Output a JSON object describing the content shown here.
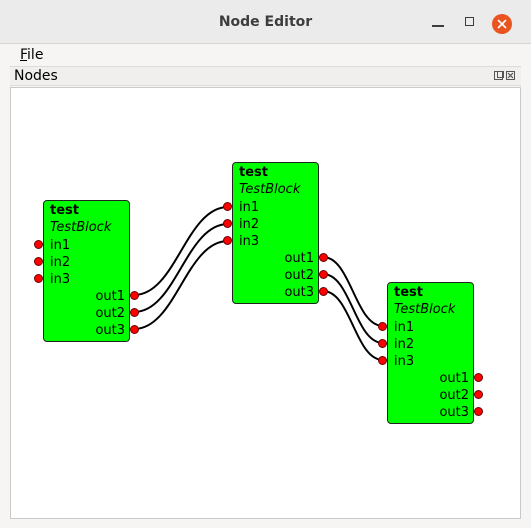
{
  "window": {
    "title": "Node Editor"
  },
  "menu": {
    "file": "File"
  },
  "dock": {
    "title": "Nodes"
  },
  "nodes": [
    {
      "title": "test",
      "type": "TestBlock",
      "inputs": [
        "in1",
        "in2",
        "in3"
      ],
      "outputs": [
        "out1",
        "out2",
        "out3"
      ]
    },
    {
      "title": "test",
      "type": "TestBlock",
      "inputs": [
        "in1",
        "in2",
        "in3"
      ],
      "outputs": [
        "out1",
        "out2",
        "out3"
      ]
    },
    {
      "title": "test",
      "type": "TestBlock",
      "inputs": [
        "in1",
        "in2",
        "in3"
      ],
      "outputs": [
        "out1",
        "out2",
        "out3"
      ]
    }
  ],
  "colors": {
    "node_fill": "#00ff00",
    "port_fill": "#ff0000",
    "wire": "#000000",
    "close_button": "#e95420"
  }
}
